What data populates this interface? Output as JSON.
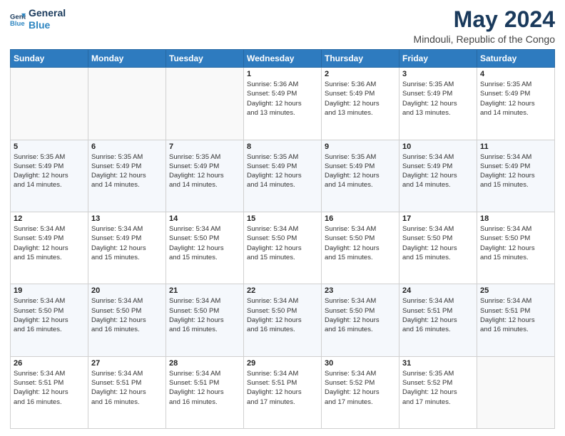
{
  "logo": {
    "line1": "General",
    "line2": "Blue"
  },
  "title": "May 2024",
  "subtitle": "Mindouli, Republic of the Congo",
  "header_days": [
    "Sunday",
    "Monday",
    "Tuesday",
    "Wednesday",
    "Thursday",
    "Friday",
    "Saturday"
  ],
  "weeks": [
    [
      {
        "day": "",
        "info": ""
      },
      {
        "day": "",
        "info": ""
      },
      {
        "day": "",
        "info": ""
      },
      {
        "day": "1",
        "info": "Sunrise: 5:36 AM\nSunset: 5:49 PM\nDaylight: 12 hours\nand 13 minutes."
      },
      {
        "day": "2",
        "info": "Sunrise: 5:36 AM\nSunset: 5:49 PM\nDaylight: 12 hours\nand 13 minutes."
      },
      {
        "day": "3",
        "info": "Sunrise: 5:35 AM\nSunset: 5:49 PM\nDaylight: 12 hours\nand 13 minutes."
      },
      {
        "day": "4",
        "info": "Sunrise: 5:35 AM\nSunset: 5:49 PM\nDaylight: 12 hours\nand 14 minutes."
      }
    ],
    [
      {
        "day": "5",
        "info": "Sunrise: 5:35 AM\nSunset: 5:49 PM\nDaylight: 12 hours\nand 14 minutes."
      },
      {
        "day": "6",
        "info": "Sunrise: 5:35 AM\nSunset: 5:49 PM\nDaylight: 12 hours\nand 14 minutes."
      },
      {
        "day": "7",
        "info": "Sunrise: 5:35 AM\nSunset: 5:49 PM\nDaylight: 12 hours\nand 14 minutes."
      },
      {
        "day": "8",
        "info": "Sunrise: 5:35 AM\nSunset: 5:49 PM\nDaylight: 12 hours\nand 14 minutes."
      },
      {
        "day": "9",
        "info": "Sunrise: 5:35 AM\nSunset: 5:49 PM\nDaylight: 12 hours\nand 14 minutes."
      },
      {
        "day": "10",
        "info": "Sunrise: 5:34 AM\nSunset: 5:49 PM\nDaylight: 12 hours\nand 14 minutes."
      },
      {
        "day": "11",
        "info": "Sunrise: 5:34 AM\nSunset: 5:49 PM\nDaylight: 12 hours\nand 15 minutes."
      }
    ],
    [
      {
        "day": "12",
        "info": "Sunrise: 5:34 AM\nSunset: 5:49 PM\nDaylight: 12 hours\nand 15 minutes."
      },
      {
        "day": "13",
        "info": "Sunrise: 5:34 AM\nSunset: 5:49 PM\nDaylight: 12 hours\nand 15 minutes."
      },
      {
        "day": "14",
        "info": "Sunrise: 5:34 AM\nSunset: 5:50 PM\nDaylight: 12 hours\nand 15 minutes."
      },
      {
        "day": "15",
        "info": "Sunrise: 5:34 AM\nSunset: 5:50 PM\nDaylight: 12 hours\nand 15 minutes."
      },
      {
        "day": "16",
        "info": "Sunrise: 5:34 AM\nSunset: 5:50 PM\nDaylight: 12 hours\nand 15 minutes."
      },
      {
        "day": "17",
        "info": "Sunrise: 5:34 AM\nSunset: 5:50 PM\nDaylight: 12 hours\nand 15 minutes."
      },
      {
        "day": "18",
        "info": "Sunrise: 5:34 AM\nSunset: 5:50 PM\nDaylight: 12 hours\nand 15 minutes."
      }
    ],
    [
      {
        "day": "19",
        "info": "Sunrise: 5:34 AM\nSunset: 5:50 PM\nDaylight: 12 hours\nand 16 minutes."
      },
      {
        "day": "20",
        "info": "Sunrise: 5:34 AM\nSunset: 5:50 PM\nDaylight: 12 hours\nand 16 minutes."
      },
      {
        "day": "21",
        "info": "Sunrise: 5:34 AM\nSunset: 5:50 PM\nDaylight: 12 hours\nand 16 minutes."
      },
      {
        "day": "22",
        "info": "Sunrise: 5:34 AM\nSunset: 5:50 PM\nDaylight: 12 hours\nand 16 minutes."
      },
      {
        "day": "23",
        "info": "Sunrise: 5:34 AM\nSunset: 5:50 PM\nDaylight: 12 hours\nand 16 minutes."
      },
      {
        "day": "24",
        "info": "Sunrise: 5:34 AM\nSunset: 5:51 PM\nDaylight: 12 hours\nand 16 minutes."
      },
      {
        "day": "25",
        "info": "Sunrise: 5:34 AM\nSunset: 5:51 PM\nDaylight: 12 hours\nand 16 minutes."
      }
    ],
    [
      {
        "day": "26",
        "info": "Sunrise: 5:34 AM\nSunset: 5:51 PM\nDaylight: 12 hours\nand 16 minutes."
      },
      {
        "day": "27",
        "info": "Sunrise: 5:34 AM\nSunset: 5:51 PM\nDaylight: 12 hours\nand 16 minutes."
      },
      {
        "day": "28",
        "info": "Sunrise: 5:34 AM\nSunset: 5:51 PM\nDaylight: 12 hours\nand 16 minutes."
      },
      {
        "day": "29",
        "info": "Sunrise: 5:34 AM\nSunset: 5:51 PM\nDaylight: 12 hours\nand 17 minutes."
      },
      {
        "day": "30",
        "info": "Sunrise: 5:34 AM\nSunset: 5:52 PM\nDaylight: 12 hours\nand 17 minutes."
      },
      {
        "day": "31",
        "info": "Sunrise: 5:35 AM\nSunset: 5:52 PM\nDaylight: 12 hours\nand 17 minutes."
      },
      {
        "day": "",
        "info": ""
      }
    ]
  ]
}
